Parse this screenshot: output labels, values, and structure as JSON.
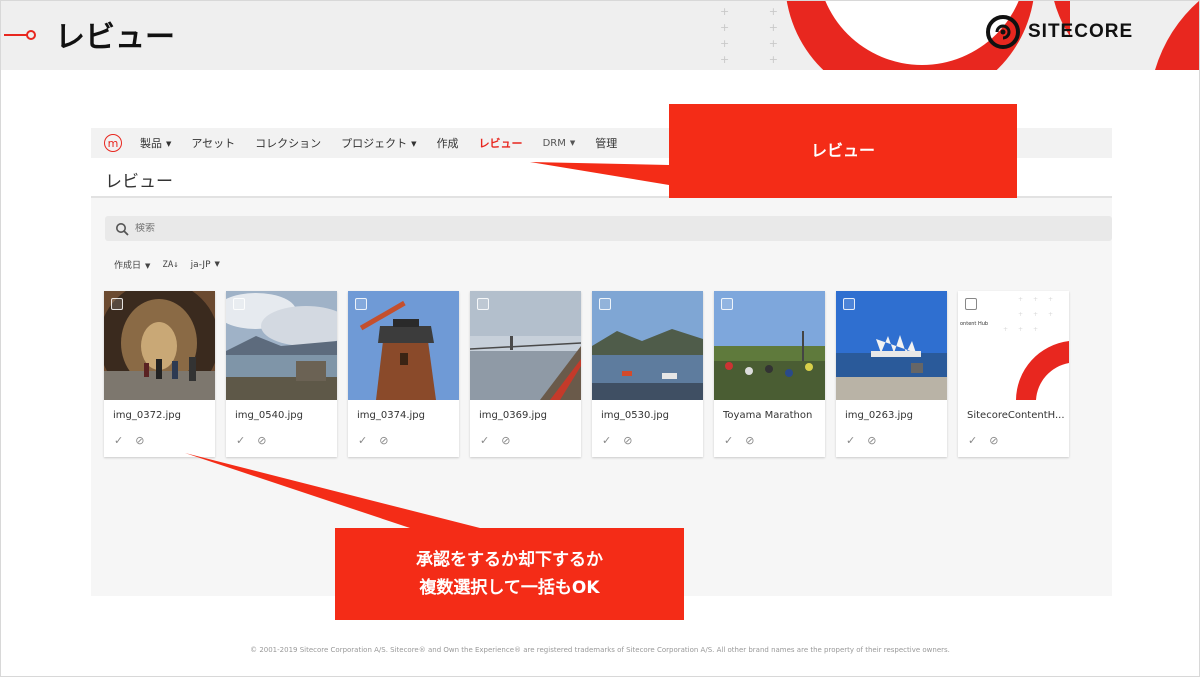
{
  "slide": {
    "title": "レビュー",
    "logo_text": "SITECORE",
    "footer": "© 2001-2019 Sitecore Corporation A/S. Sitecore® and Own the Experience® are registered trademarks of Sitecore Corporation A/S. All other brand names are the property of their respective owners.",
    "brand_color": "#e8271f"
  },
  "app": {
    "logo_letter": "m",
    "nav": [
      {
        "label": "製品",
        "dropdown": true
      },
      {
        "label": "アセット",
        "dropdown": false
      },
      {
        "label": "コレクション",
        "dropdown": false
      },
      {
        "label": "プロジェクト",
        "dropdown": true
      },
      {
        "label": "作成",
        "dropdown": false
      },
      {
        "label": "レビュー",
        "dropdown": false,
        "active": true
      },
      {
        "label": "DRM",
        "dropdown": true
      },
      {
        "label": "管理",
        "dropdown": false
      }
    ],
    "page_heading": "レビュー",
    "search_placeholder": "検索",
    "sort_field": "作成日",
    "sort_icon": "ZA↓",
    "language": "ja-JP",
    "assets": [
      {
        "name": "img_0372.jpg",
        "thumb": "tunnel"
      },
      {
        "name": "img_0540.jpg",
        "thumb": "mountain-lake"
      },
      {
        "name": "img_0374.jpg",
        "thumb": "lighthouse"
      },
      {
        "name": "img_0369.jpg",
        "thumb": "bridge"
      },
      {
        "name": "img_0530.jpg",
        "thumb": "harbor"
      },
      {
        "name": "Toyama Marathon",
        "thumb": "crowd"
      },
      {
        "name": "img_0263.jpg",
        "thumb": "ship"
      },
      {
        "name": "SitecoreContentH...",
        "thumb": "content-hub"
      }
    ],
    "approve_icon": "check-icon",
    "reject_icon": "ban-icon"
  },
  "callouts": {
    "top": "レビュー",
    "bottom_line1": "承認をするか却下するか",
    "bottom_line2": "複数選択して一括もOK"
  }
}
